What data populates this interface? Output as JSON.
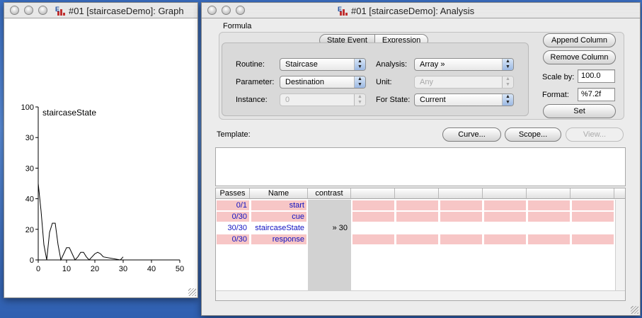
{
  "graph_window": {
    "title": "#01 [staircaseDemo]: Graph"
  },
  "chart_data": {
    "type": "line",
    "series": [
      {
        "name": "staircaseState",
        "x": [
          0,
          1,
          2,
          3,
          4,
          5,
          6,
          7,
          8,
          9,
          10,
          11,
          12,
          13,
          14,
          15,
          16,
          17,
          18,
          19,
          20,
          21,
          22,
          23,
          29,
          30
        ],
        "y": [
          50,
          32,
          10,
          0,
          18,
          24,
          24,
          10,
          0,
          4,
          8,
          8,
          4,
          0,
          2,
          5,
          5,
          2,
          0,
          2,
          4,
          5,
          4,
          2,
          0,
          2
        ]
      }
    ],
    "xlim": [
      0,
      50
    ],
    "ylim": [
      0,
      100
    ],
    "xticks": [
      "0",
      "10",
      "20",
      "30",
      "40",
      "50"
    ],
    "yticks": [
      "0",
      "20",
      "40",
      "30",
      "30",
      "100"
    ],
    "series_label": "staircaseState"
  },
  "analysis_window": {
    "title": "#01 [staircaseDemo]: Analysis",
    "formula_label": "Formula",
    "tabs": [
      "State Event",
      "Expression"
    ],
    "routine_label": "Routine:",
    "routine_value": "Staircase",
    "parameter_label": "Parameter:",
    "parameter_value": "Destination",
    "instance_label": "Instance:",
    "instance_value": "0",
    "analysis_label": "Analysis:",
    "analysis_value": "Array »",
    "unit_label": "Unit:",
    "unit_value": "Any",
    "for_state_label": "For State:",
    "for_state_value": "Current",
    "append_column": "Append Column",
    "remove_column": "Remove Column",
    "scale_by_label": "Scale by:",
    "scale_by_value": "100.0",
    "format_label": "Format:",
    "format_value": "%7.2f",
    "set_button": "Set",
    "template_label": "Template:",
    "curve_button": "Curve...",
    "scope_button": "Scope...",
    "view_button": "View...",
    "table": {
      "headers": [
        "Passes",
        "Name",
        "contrast"
      ],
      "rows": [
        {
          "passes": "0/1",
          "name": "start",
          "contrast": "",
          "highlight": true
        },
        {
          "passes": "0/30",
          "name": "cue",
          "contrast": "",
          "highlight": true
        },
        {
          "passes": "30/30",
          "name": "staircaseState",
          "contrast": "» 30",
          "highlight": false
        },
        {
          "passes": "0/30",
          "name": "response",
          "contrast": "",
          "highlight": true
        }
      ]
    }
  },
  "colors": {
    "highlight": "#f7c6c6",
    "table_text": "#1010c0",
    "desktop": "#3a6fc4"
  }
}
